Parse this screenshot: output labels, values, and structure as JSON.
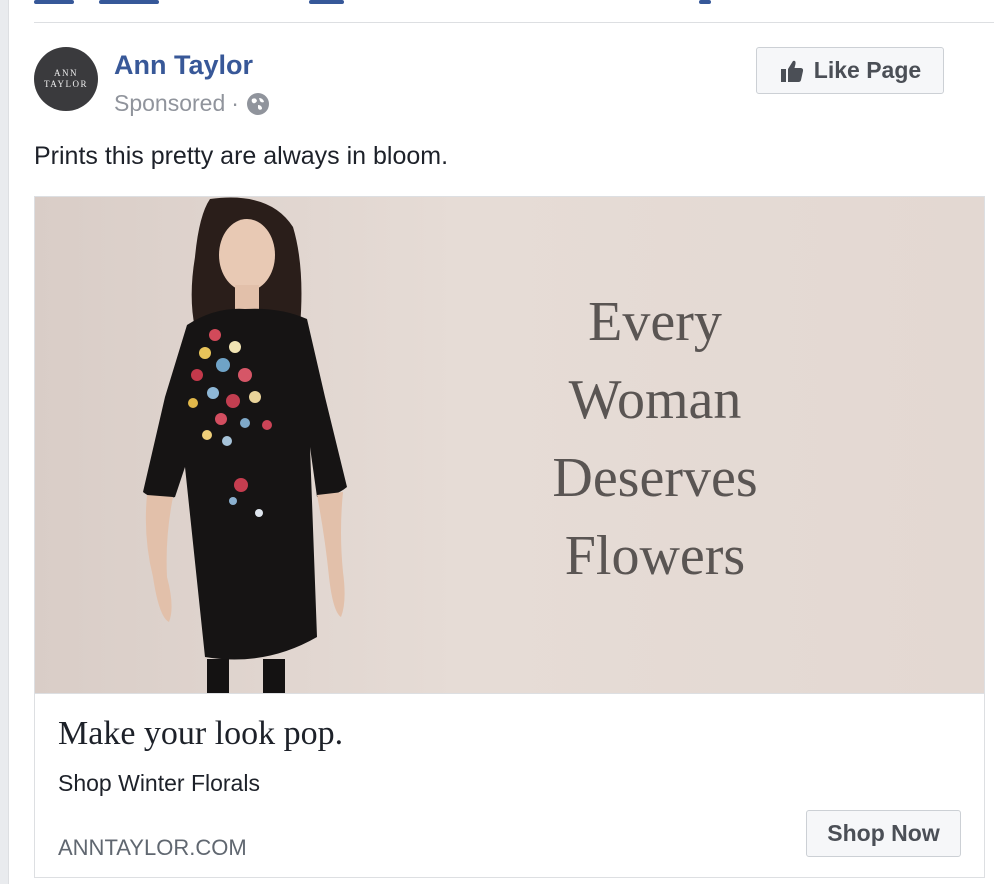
{
  "post": {
    "page_name": "Ann Taylor",
    "avatar_text_line1": "ANN",
    "avatar_text_line2": "TAYLOR",
    "sponsored_label": "Sponsored",
    "separator": "·",
    "like_page_label": "Like Page",
    "caption": "Prints this pretty are always in bloom."
  },
  "ad": {
    "image_text": [
      "Every",
      "Woman",
      "Deserves",
      "Flowers"
    ],
    "headline": "Make your look pop.",
    "description": "Shop Winter Florals",
    "domain": "ANNTAYLOR.COM",
    "cta_label": "Shop Now"
  },
  "colors": {
    "link_blue": "#385898",
    "meta_gray": "#90949c",
    "button_bg": "#f6f7f9"
  },
  "icons": {
    "like_button": "thumbs-up-icon",
    "audience": "globe-icon"
  }
}
